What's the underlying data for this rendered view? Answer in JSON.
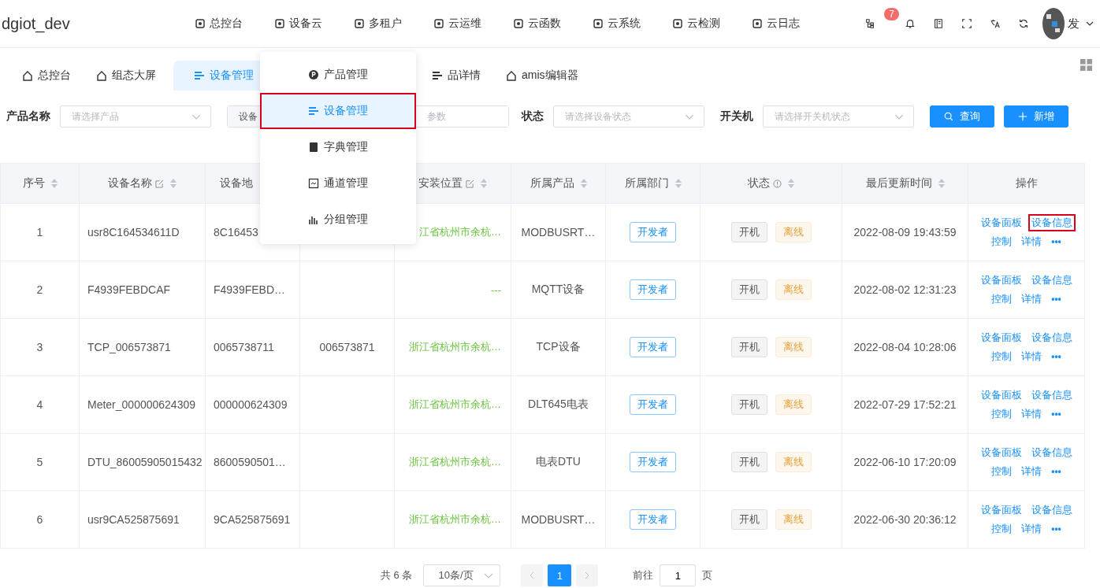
{
  "header": {
    "brand": "dgiot_dev",
    "nav": [
      {
        "label": "总控台"
      },
      {
        "label": "设备云"
      },
      {
        "label": "多租户"
      },
      {
        "label": "云运维"
      },
      {
        "label": "云函数"
      },
      {
        "label": "云系统"
      },
      {
        "label": "云检测"
      },
      {
        "label": "云日志"
      }
    ],
    "badge": "7",
    "user": "发"
  },
  "tabs": [
    {
      "label": "总控台",
      "selected": false
    },
    {
      "label": "组态大屏",
      "selected": false
    },
    {
      "label": "设备管理",
      "selected": true
    },
    {
      "label": "品详情",
      "selected": false
    },
    {
      "label": "amis编辑器",
      "selected": false
    }
  ],
  "filters": {
    "product_label": "产品名称",
    "product_placeholder": "请选择产品",
    "device_prefix": "设备",
    "param_placeholder": "参数",
    "status_label": "状态",
    "status_placeholder": "请选择设备状态",
    "power_label": "开关机",
    "power_placeholder": "请选择开关机状态",
    "query": "查询",
    "add": "新增"
  },
  "menu": [
    {
      "label": "产品管理",
      "selected": false,
      "outlined": false
    },
    {
      "label": "设备管理",
      "selected": true,
      "outlined": true
    },
    {
      "label": "字典管理",
      "selected": false,
      "outlined": false
    },
    {
      "label": "通道管理",
      "selected": false,
      "outlined": false
    },
    {
      "label": "分组管理",
      "selected": false,
      "outlined": false
    }
  ],
  "table": {
    "columns": [
      {
        "label": "序号",
        "sortable": true,
        "editable": false,
        "info": false
      },
      {
        "label": "设备名称",
        "sortable": true,
        "editable": true,
        "info": false
      },
      {
        "label": "设备地"
      },
      {},
      {
        "label": "安装位置",
        "sortable": true,
        "editable": true,
        "info": false
      },
      {
        "label": "所属产品",
        "sortable": true,
        "editable": false,
        "info": false
      },
      {
        "label": "所属部门",
        "sortable": true,
        "editable": false,
        "info": false
      },
      {
        "label": "状态",
        "sortable": true,
        "editable": false,
        "info": true
      },
      {
        "label": "最后更新时间",
        "sortable": true,
        "editable": false,
        "info": false
      },
      {
        "label": "操作",
        "sortable": false,
        "editable": false,
        "info": false
      }
    ],
    "rows": [
      {
        "index": "1",
        "name": "usr8C164534611D",
        "address": "8C16453",
        "location": "江省杭州市余杭…",
        "product": "MODBUSRT…",
        "dept": "开发者",
        "power": "开机",
        "status": "离线",
        "time": "2022-08-09 19:43:59",
        "actions": [
          {
            "label": "设备面板",
            "outlined": false
          },
          {
            "label": "设备信息",
            "outlined": true
          },
          {
            "label": "控制",
            "outlined": false
          },
          {
            "label": "详情",
            "outlined": false
          },
          {
            "label": "•••",
            "outlined": false
          }
        ]
      },
      {
        "index": "2",
        "name": "F4939FEBDCAF",
        "address": "F4939FEBD…",
        "location": "---",
        "product": "MQTT设备",
        "dept": "开发者",
        "power": "开机",
        "status": "离线",
        "time": "2022-08-02 12:31:23",
        "actions": [
          {
            "label": "设备面板",
            "outlined": false
          },
          {
            "label": "设备信息",
            "outlined": false
          },
          {
            "label": "控制",
            "outlined": false
          },
          {
            "label": "详情",
            "outlined": false
          },
          {
            "label": "•••",
            "outlined": false
          }
        ]
      },
      {
        "index": "3",
        "name": "TCP_006573871",
        "address": "0065738711",
        "column_4": "006573871",
        "location": "浙江省杭州市余杭…",
        "product": "TCP设备",
        "dept": "开发者",
        "power": "开机",
        "status": "离线",
        "time": "2022-08-04 10:28:06",
        "actions": [
          {
            "label": "设备面板",
            "outlined": false
          },
          {
            "label": "设备信息",
            "outlined": false
          },
          {
            "label": "控制",
            "outlined": false
          },
          {
            "label": "详情",
            "outlined": false
          },
          {
            "label": "•••",
            "outlined": false
          }
        ]
      },
      {
        "index": "4",
        "name": "Meter_000000624309",
        "address": "000000624309",
        "location": "浙江省杭州市余杭…",
        "product": "DLT645电表",
        "dept": "开发者",
        "power": "开机",
        "status": "离线",
        "time": "2022-07-29 17:52:21",
        "actions": [
          {
            "label": "设备面板",
            "outlined": false
          },
          {
            "label": "设备信息",
            "outlined": false
          },
          {
            "label": "控制",
            "outlined": false
          },
          {
            "label": "详情",
            "outlined": false
          },
          {
            "label": "•••",
            "outlined": false
          }
        ]
      },
      {
        "index": "5",
        "name": "DTU_86005905015432",
        "address": "8600590501…",
        "location": "浙江省杭州市余杭…",
        "product": "电表DTU",
        "dept": "开发者",
        "power": "开机",
        "status": "离线",
        "time": "2022-06-10 17:20:09",
        "actions": [
          {
            "label": "设备面板",
            "outlined": false
          },
          {
            "label": "设备信息",
            "outlined": false
          },
          {
            "label": "控制",
            "outlined": false
          },
          {
            "label": "详情",
            "outlined": false
          },
          {
            "label": "•••",
            "outlined": false
          }
        ]
      },
      {
        "index": "6",
        "name": "usr9CA525875691",
        "address": "9CA525875691",
        "location": "浙江省杭州市余杭…",
        "product": "MODBUSRT…",
        "dept": "开发者",
        "power": "开机",
        "status": "离线",
        "time": "2022-06-30 20:36:12",
        "actions": [
          {
            "label": "设备面板",
            "outlined": false
          },
          {
            "label": "设备信息",
            "outlined": false
          },
          {
            "label": "控制",
            "outlined": false
          },
          {
            "label": "详情",
            "outlined": false
          },
          {
            "label": "•••",
            "outlined": false
          }
        ]
      }
    ]
  },
  "pagination": {
    "total": "共 6 条",
    "page_size": "10条/页",
    "pages": [
      {
        "label": "1",
        "selected": true
      }
    ],
    "goto": "前往",
    "goto_value": "1",
    "goto_suffix": "页"
  }
}
